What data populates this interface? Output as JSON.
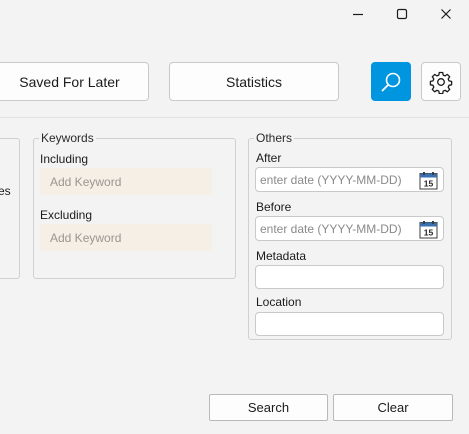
{
  "window": {
    "minimize_icon": "minimize-icon",
    "maximize_icon": "maximize-icon",
    "close_icon": "close-icon"
  },
  "nav": {
    "saved_for_later": "Saved For Later",
    "statistics": "Statistics",
    "search_icon": "search-icon",
    "settings_icon": "gear-icon",
    "accent_color": "#0095df"
  },
  "left_panel": {
    "partial_text": "es"
  },
  "keywords": {
    "title": "Keywords",
    "including_label": "Including",
    "including_placeholder": "Add Keyword",
    "excluding_label": "Excluding",
    "excluding_placeholder": "Add Keyword"
  },
  "others": {
    "title": "Others",
    "after_label": "After",
    "after_placeholder": "enter date (YYYY-MM-DD)",
    "before_label": "Before",
    "before_placeholder": "enter date (YYYY-MM-DD)",
    "calendar_day": "15",
    "metadata_label": "Metadata",
    "metadata_value": "",
    "location_label": "Location",
    "location_value": ""
  },
  "actions": {
    "search": "Search",
    "clear": "Clear"
  }
}
